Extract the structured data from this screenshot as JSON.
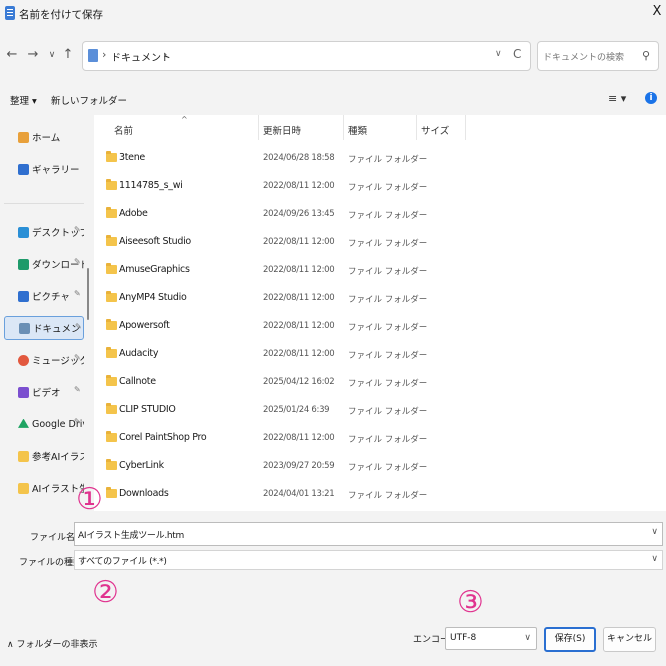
{
  "window": {
    "title": "名前を付けて保存",
    "close_glyph": "X"
  },
  "nav": {
    "back": "←",
    "forward": "→",
    "recent": "∨",
    "up": "↑",
    "address_crumb": "ドキュメント",
    "address_sep": "›",
    "address_dropdown": "∨",
    "refresh": "C",
    "search_placeholder": "ドキュメントの検索",
    "search_icon": "search-icon"
  },
  "toolbar": {
    "organize": "整理 ▾",
    "new_folder": "新しいフォルダー",
    "view_menu": "≡ ▾",
    "help": "i"
  },
  "sidebar": {
    "items": [
      {
        "label": "ホーム",
        "icon": "home-icon",
        "color": "#e8a03a",
        "pinned": false
      },
      {
        "label": "ギャラリー",
        "icon": "gallery-icon",
        "color": "#2f6fcf",
        "pinned": false
      },
      {
        "label": "デスクトップ",
        "icon": "desktop-icon",
        "color": "#2a8fd6",
        "pinned": true
      },
      {
        "label": "ダウンロード",
        "icon": "download-icon",
        "color": "#1e9a6a",
        "pinned": true
      },
      {
        "label": "ピクチャ",
        "icon": "pictures-icon",
        "color": "#2f6fcf",
        "pinned": true
      },
      {
        "label": "ドキュメント",
        "icon": "documents-icon",
        "color": "#6a8fb5",
        "pinned": true
      },
      {
        "label": "ミュージック",
        "icon": "music-icon",
        "color": "#e2583e",
        "pinned": true
      },
      {
        "label": "ビデオ",
        "icon": "video-icon",
        "color": "#7b4fcf",
        "pinned": true
      },
      {
        "label": "Google Drive",
        "icon": "google-drive-icon",
        "color": "#1fa463",
        "pinned": true
      },
      {
        "label": "参考AIイラスト",
        "icon": "folder-icon",
        "color": "#f4c44b",
        "pinned": false
      },
      {
        "label": "AIイラスト生成ツ",
        "icon": "folder-icon",
        "color": "#f4c44b",
        "pinned": false
      }
    ],
    "pin_glyph": "📌"
  },
  "files": {
    "columns": [
      "名前",
      "更新日時",
      "種類",
      "サイズ"
    ],
    "sort_glyph": "^",
    "rows": [
      {
        "name": "3tene",
        "date": "2024/06/28 18:58",
        "type": "ファイル フォルダー"
      },
      {
        "name": "1114785_s_wi",
        "date": "2022/08/11 12:00",
        "type": "ファイル フォルダー"
      },
      {
        "name": "Adobe",
        "date": "2024/09/26 13:45",
        "type": "ファイル フォルダー"
      },
      {
        "name": "Aiseesoft Studio",
        "date": "2022/08/11 12:00",
        "type": "ファイル フォルダー"
      },
      {
        "name": "AmuseGraphics",
        "date": "2022/08/11 12:00",
        "type": "ファイル フォルダー"
      },
      {
        "name": "AnyMP4 Studio",
        "date": "2022/08/11 12:00",
        "type": "ファイル フォルダー"
      },
      {
        "name": "Apowersoft",
        "date": "2022/08/11 12:00",
        "type": "ファイル フォルダー"
      },
      {
        "name": "Audacity",
        "date": "2022/08/11 12:00",
        "type": "ファイル フォルダー"
      },
      {
        "name": "Callnote",
        "date": "2025/04/12 16:02",
        "type": "ファイル フォルダー"
      },
      {
        "name": "CLIP STUDIO",
        "date": "2025/01/24 6:39",
        "type": "ファイル フォルダー"
      },
      {
        "name": "Corel PaintShop Pro",
        "date": "2022/08/11 12:00",
        "type": "ファイル フォルダー"
      },
      {
        "name": "CyberLink",
        "date": "2023/09/27 20:59",
        "type": "ファイル フォルダー"
      },
      {
        "name": "Downloads",
        "date": "2024/04/01 13:21",
        "type": "ファイル フォルダー"
      }
    ]
  },
  "form": {
    "filename_label": "ファイル名(N):",
    "filename_value": "AIイラスト生成ツール.htm",
    "filetype_label": "ファイルの種類(T):",
    "filetype_value": "すべてのファイル (*.*)",
    "chevron": "∨"
  },
  "annotations": {
    "one": "①",
    "two": "②",
    "three": "③",
    "color": "#e0338f"
  },
  "footer": {
    "hide_folders": "∧ フォルダーの非表示",
    "encoding_label": "エンコード:",
    "encoding_value": "UTF-8",
    "save": "保存(S)",
    "cancel": "キャンセル"
  }
}
